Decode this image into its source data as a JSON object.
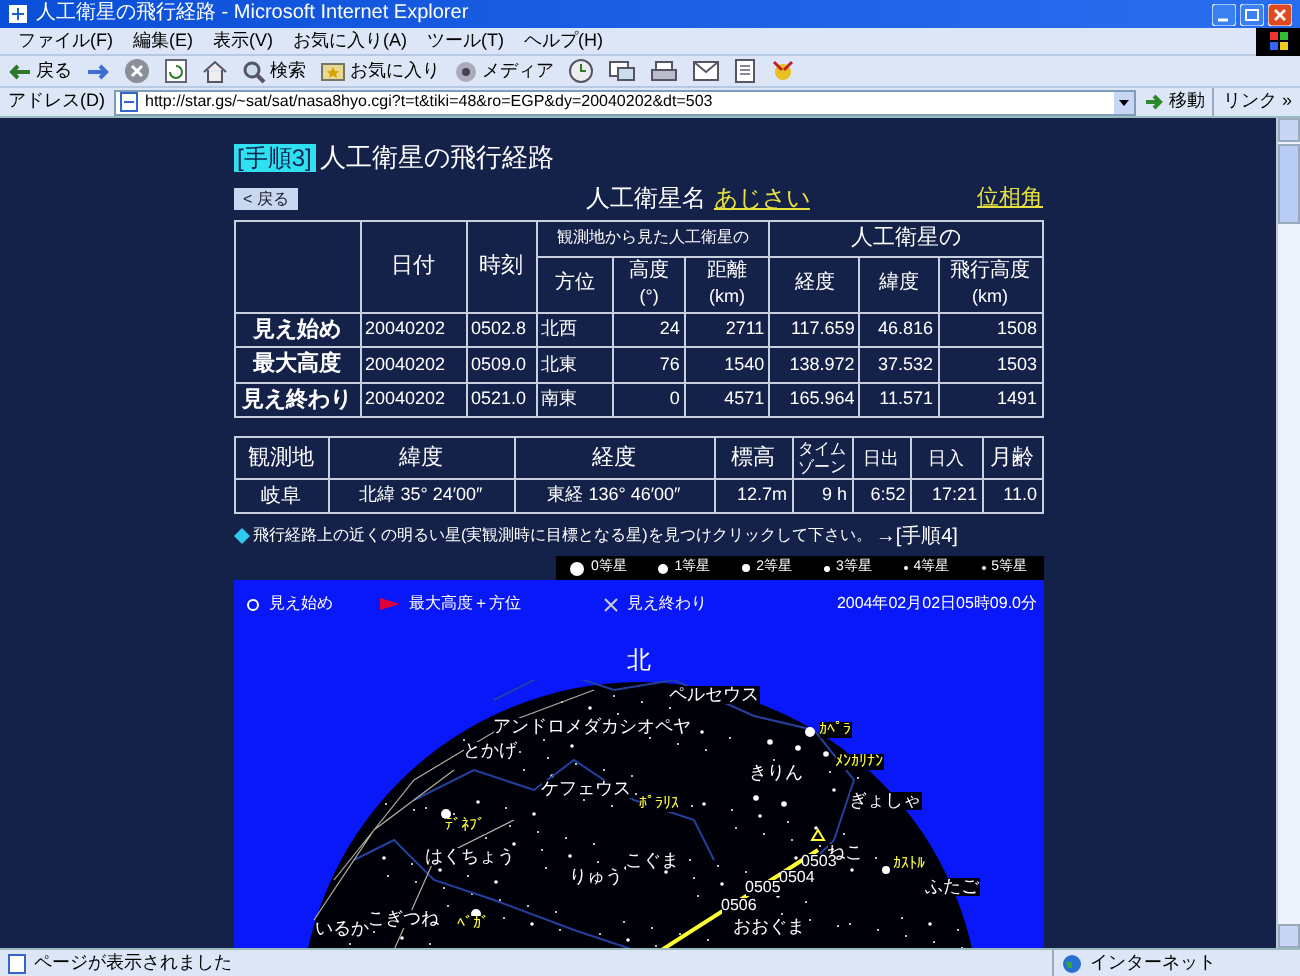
{
  "window": {
    "title": "人工衛星の飛行経路 - Microsoft Internet Explorer"
  },
  "menu": [
    "ファイル(F)",
    "編集(E)",
    "表示(V)",
    "お気に入り(A)",
    "ツール(T)",
    "ヘルプ(H)"
  ],
  "toolbar": [
    {
      "kind": "back",
      "label": "戻る"
    },
    {
      "kind": "forward"
    },
    {
      "kind": "stop"
    },
    {
      "kind": "refresh"
    },
    {
      "kind": "home"
    },
    {
      "kind": "search",
      "label": "検索"
    },
    {
      "kind": "favorites",
      "label": "お気に入り"
    },
    {
      "kind": "media",
      "label": "メディア"
    },
    {
      "kind": "history"
    },
    {
      "kind": "mail"
    },
    {
      "kind": "print"
    },
    {
      "kind": "edit"
    },
    {
      "kind": "discuss"
    },
    {
      "kind": "messenger"
    }
  ],
  "address": {
    "label": "アドレス(D)",
    "url": "http://star.gs/~sat/sat/nasa8hyo.cgi?t=t&tiki=48&ro=EGP&dy=20040202&dt=503",
    "go": "移動",
    "links": "リンク »"
  },
  "page": {
    "step_badge": "[手順3]",
    "title": "人工衛星の飛行経路",
    "back_button": "< 戻る",
    "satellite_label": "人工衛星名",
    "satellite_name": "あじさい",
    "phase_link": "位相角"
  },
  "pass_table": {
    "columns": [
      {
        "label": "日付"
      },
      {
        "label": "時刻"
      }
    ],
    "groups": [
      {
        "label": "観測地から見た人工衛星の",
        "columns": [
          {
            "label": "方位"
          },
          {
            "label": "高度",
            "unit": "(°)"
          },
          {
            "label": "距離",
            "unit": "(km)"
          }
        ]
      },
      {
        "label": "人工衛星の",
        "columns": [
          {
            "label": "経度"
          },
          {
            "label": "緯度"
          },
          {
            "label": "飛行高度",
            "unit": "(km)"
          }
        ]
      }
    ],
    "rows": [
      {
        "label": "見え始め",
        "cells": [
          "20040202",
          "0502.8",
          "北西",
          "24",
          "2711",
          "117.659",
          "46.816",
          "1508"
        ]
      },
      {
        "label": "最大高度",
        "cells": [
          "20040202",
          "0509.0",
          "北東",
          "76",
          "1540",
          "138.972",
          "37.532",
          "1503"
        ]
      },
      {
        "label": "見え終わり",
        "cells": [
          "20040202",
          "0521.0",
          "南東",
          "0",
          "4571",
          "165.964",
          "11.571",
          "1491"
        ]
      }
    ]
  },
  "site_table": {
    "columns": [
      "観測地",
      "緯度",
      "経度",
      "標高",
      "タイムゾーン",
      "日出",
      "日入",
      "月齢"
    ],
    "rows": [
      [
        "岐阜",
        "北緯 35° 24′00″",
        "東経 136° 46′00″",
        "12.7m",
        "9 h",
        "6:52",
        "17:21",
        "11.0"
      ]
    ]
  },
  "instruction": {
    "text": "飛行経路上の近くの明るい星(実観測時に目標となる星)を見つけクリックして下さい。",
    "link": "→[手順4]"
  },
  "magnitude_legend": [
    "0等星",
    "1等星",
    "2等星",
    "3等星",
    "4等星",
    "5等星"
  ],
  "sky_map": {
    "legend": [
      {
        "kind": "start",
        "label": "見え始め"
      },
      {
        "kind": "max",
        "label": "最大高度＋方位"
      },
      {
        "kind": "end",
        "label": "見え終わり"
      }
    ],
    "datetime": "2004年02月02日05時09.0分",
    "labels": [
      {
        "kind": "direction",
        "text": "北"
      },
      {
        "kind": "constellation",
        "text": "ペルセウス"
      },
      {
        "kind": "constellation",
        "text": "アンドロメダ"
      },
      {
        "kind": "constellation",
        "text": "カシオペヤ"
      },
      {
        "kind": "constellation",
        "text": "とかげ"
      },
      {
        "kind": "constellation",
        "text": "ケフェウス"
      },
      {
        "kind": "star",
        "text": "ﾎﾟﾗﾘｽ"
      },
      {
        "kind": "star",
        "text": "ﾃﾞﾈﾌﾞ"
      },
      {
        "kind": "constellation",
        "text": "はくちょう"
      },
      {
        "kind": "constellation",
        "text": "こぐま"
      },
      {
        "kind": "constellation",
        "text": "りゅう"
      },
      {
        "kind": "constellation",
        "text": "こぎつね"
      },
      {
        "kind": "constellation",
        "text": "いるか"
      },
      {
        "kind": "star",
        "text": "ﾍﾞｶﾞ"
      },
      {
        "kind": "star",
        "text": "ｶﾍﾟﾗ"
      },
      {
        "kind": "star",
        "text": "ﾒﾝｶﾘﾅﾝ"
      },
      {
        "kind": "constellation",
        "text": "きりん"
      },
      {
        "kind": "constellation",
        "text": "ぎょしゃ"
      },
      {
        "kind": "constellation",
        "text": "ねこ"
      },
      {
        "kind": "time",
        "text": "0503"
      },
      {
        "kind": "time",
        "text": "0504"
      },
      {
        "kind": "time",
        "text": "0505"
      },
      {
        "kind": "time",
        "text": "0506"
      },
      {
        "kind": "constellation",
        "text": "おおぐま"
      },
      {
        "kind": "star",
        "text": "ｶｽﾄﾙ"
      },
      {
        "kind": "constellation",
        "text": "ふたご"
      }
    ]
  },
  "status_bar": {
    "text": "ページが表示されました",
    "zone": "インターネット"
  }
}
